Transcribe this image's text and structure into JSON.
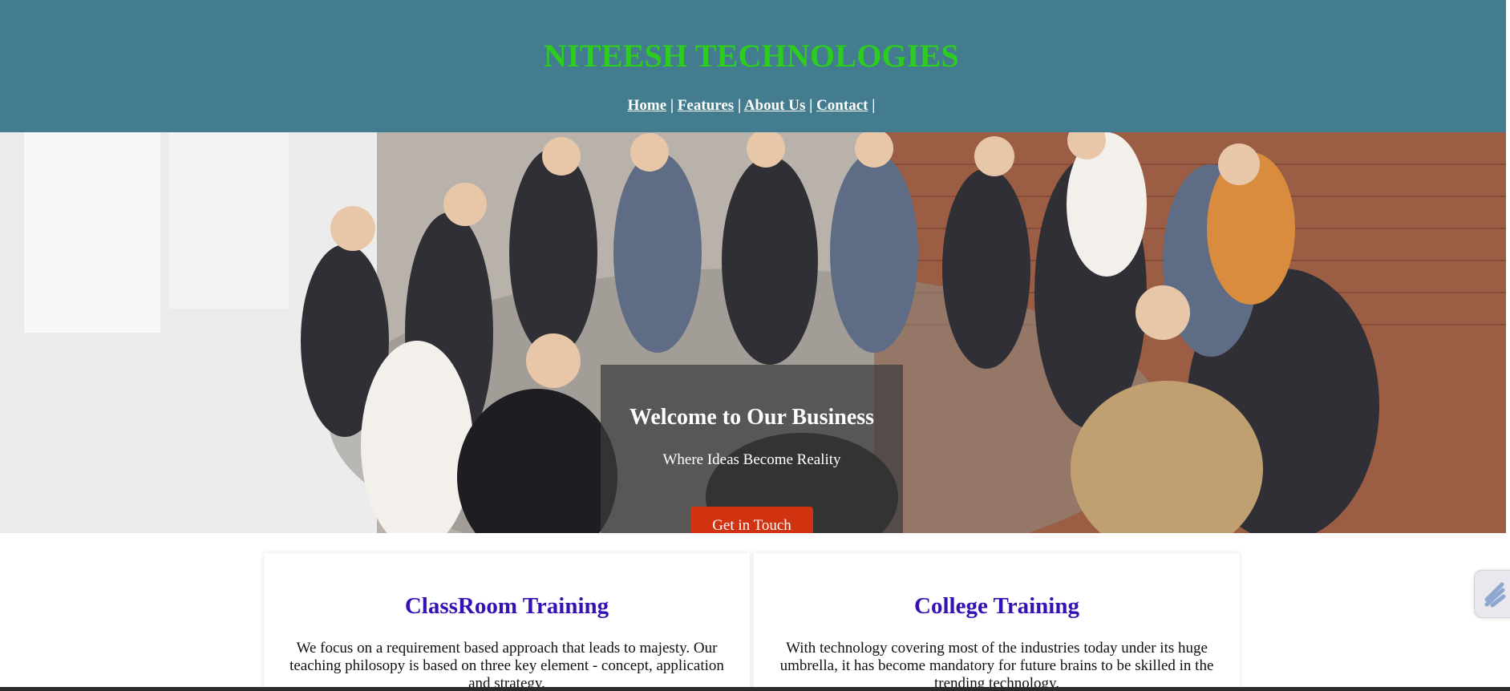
{
  "header": {
    "brand": "NITEESH TECHNOLOGIES",
    "nav": [
      {
        "label": "Home"
      },
      {
        "label": "Features"
      },
      {
        "label": "About Us"
      },
      {
        "label": "Contact"
      }
    ],
    "separator": " | "
  },
  "hero": {
    "title": "Welcome to Our Business",
    "subtitle": "Where Ideas Become Reality",
    "cta_label": "Get in Touch",
    "image_subject": "group of people sitting in a circle in a brick-walled room"
  },
  "cards": [
    {
      "title": "ClassRoom Training",
      "text": "We focus on a requirement based approach that leads to majesty. Our teaching philosopy is based on three key element - concept, application and strategy."
    },
    {
      "title": "College Training",
      "text": "With technology covering most of the industries today under its huge umbrella, it has become mandatory for future brains to be skilled in the trending technology."
    }
  ],
  "colors": {
    "header_bg": "#437b8f",
    "brand": "#2ccd1f",
    "cta_bg": "#d1320f",
    "card_title": "#3510b4"
  },
  "side_widget": {
    "icon": "floating-tool-icon"
  }
}
